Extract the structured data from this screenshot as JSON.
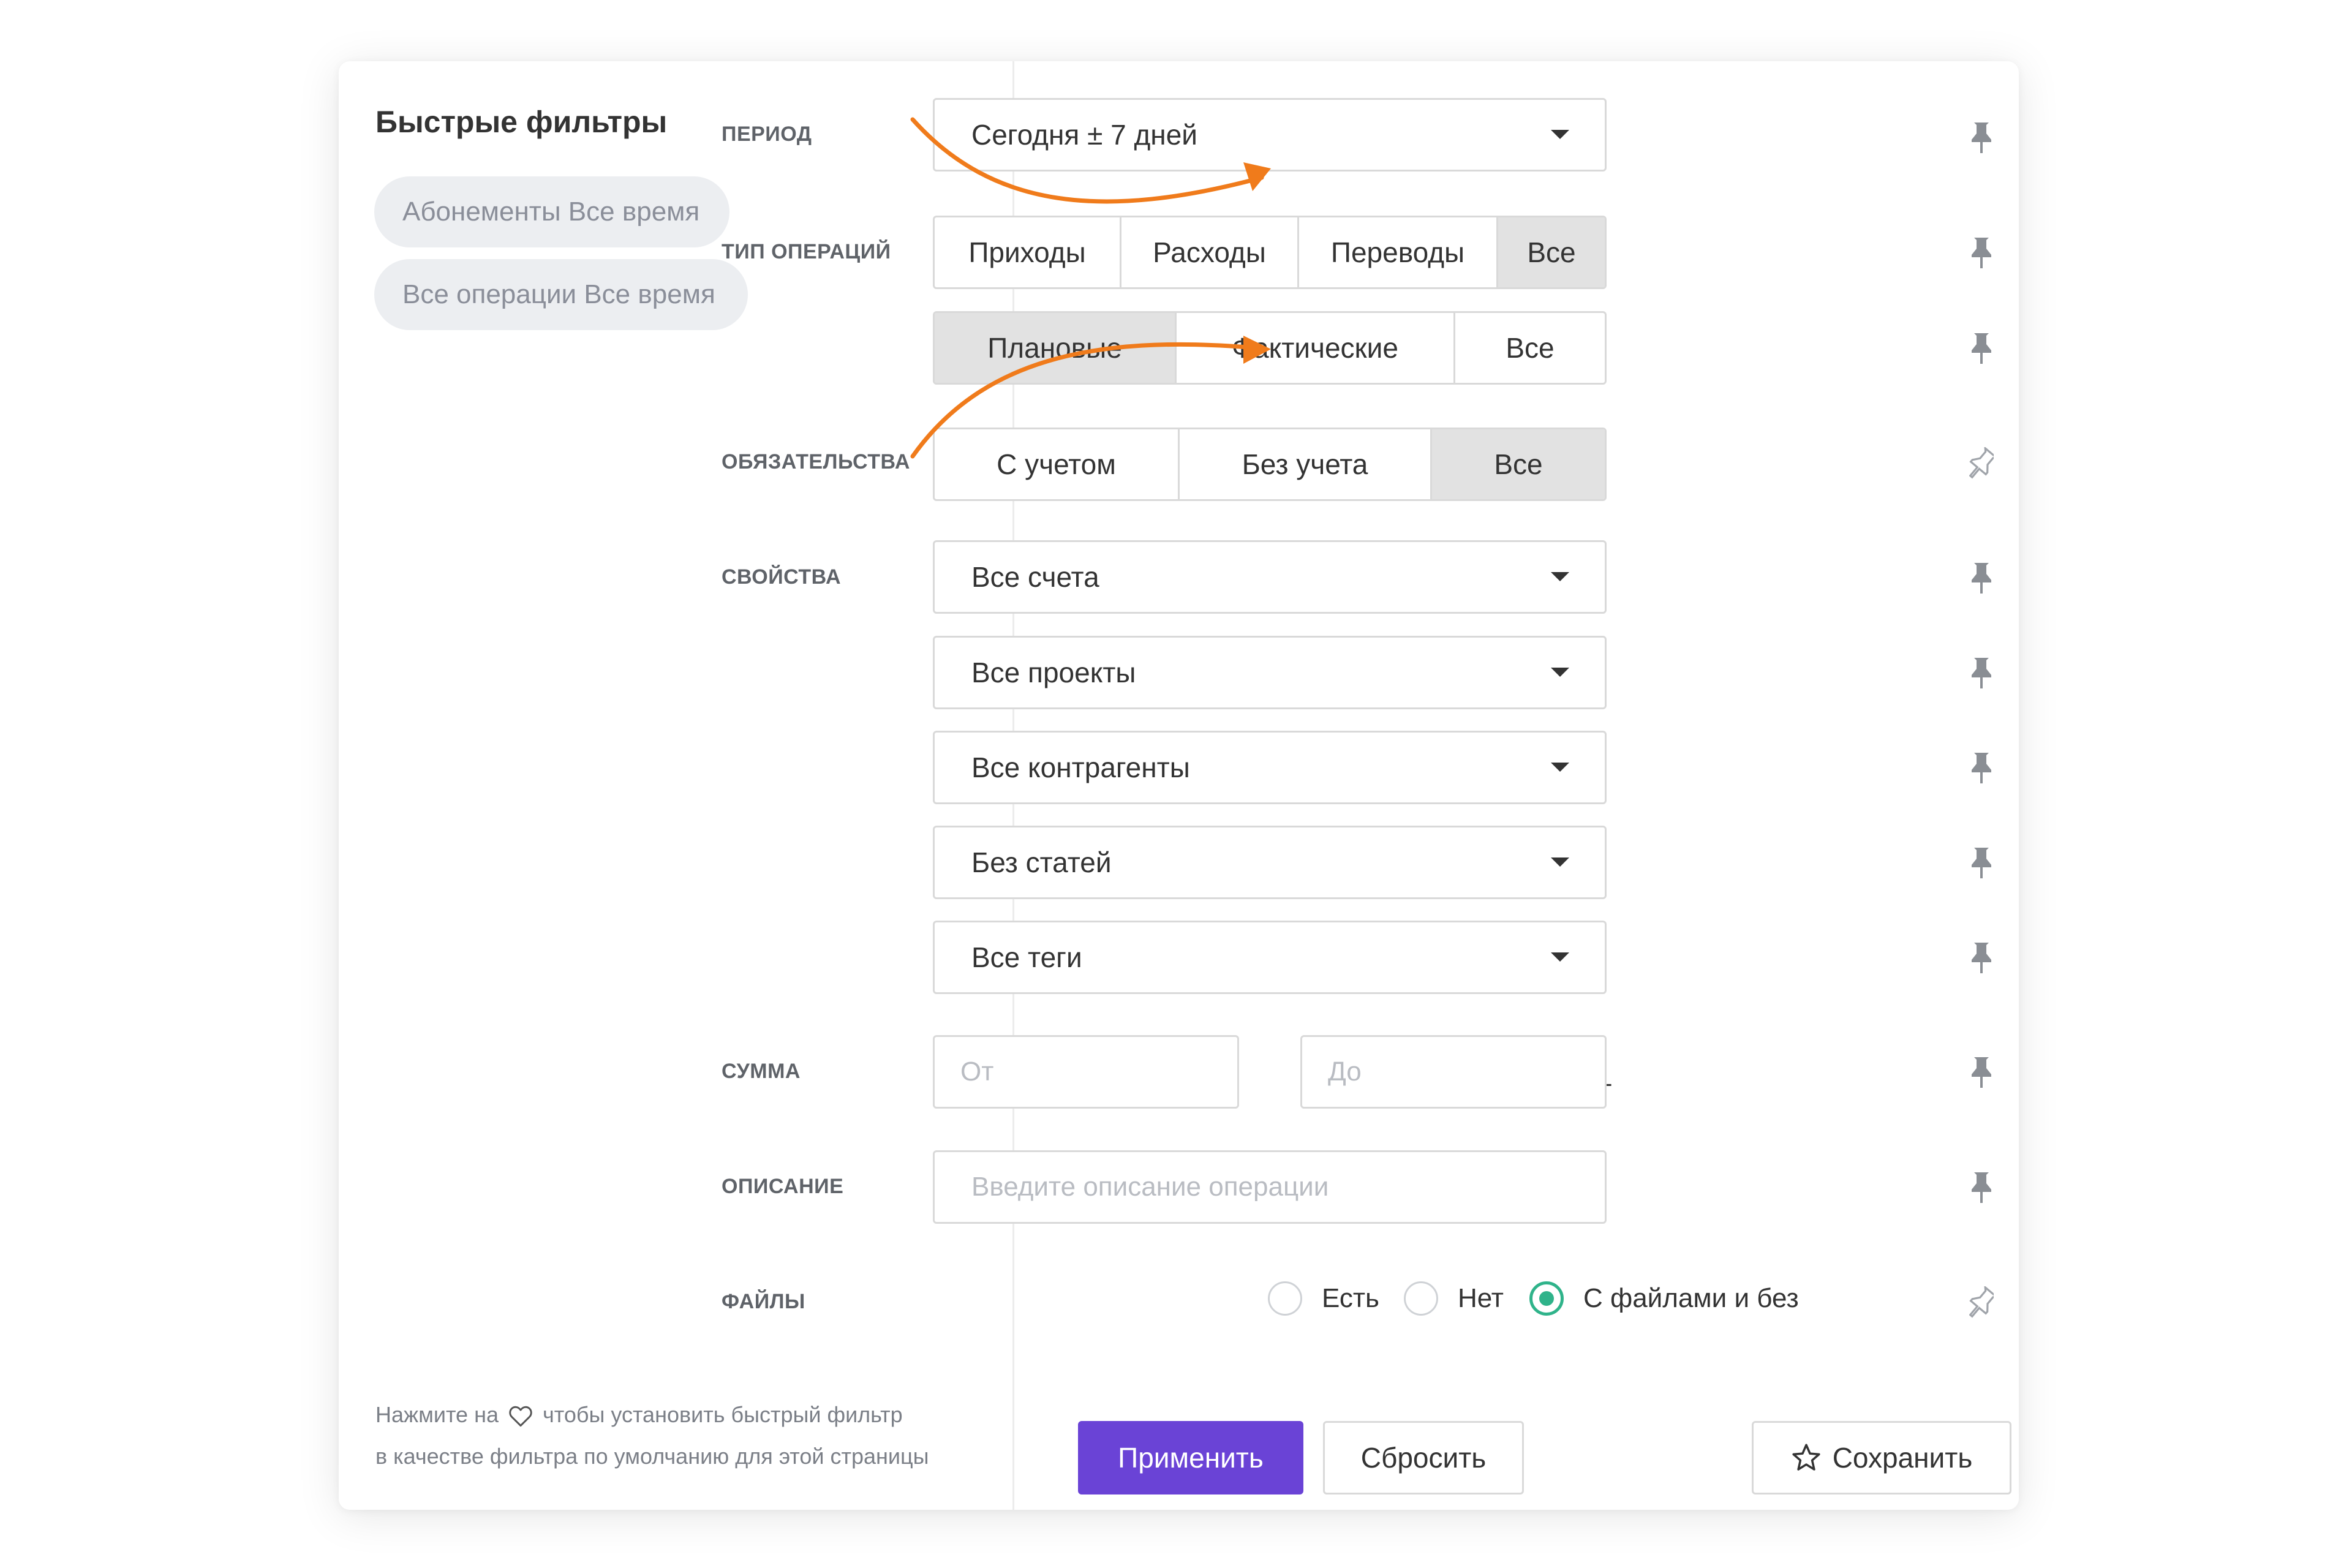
{
  "quick_filters": {
    "title": "Быстрые фильтры",
    "chips": [
      "Абонементы Все время",
      "Все операции Все время"
    ],
    "hint_line1_a": "Нажмите на",
    "hint_line1_b": "чтобы установить быстрый фильтр",
    "hint_line2": "в качестве фильтра по умолчанию для этой страницы"
  },
  "filters": {
    "period": {
      "label": "ПЕРИОД",
      "value": "Сегодня ± 7 дней"
    },
    "operation_type": {
      "label": "ТИП ОПЕРАЦИЙ",
      "kinds": [
        "Приходы",
        "Расходы",
        "Переводы",
        "Все"
      ],
      "kinds_active": "Все",
      "planning": [
        "Плановые",
        "Фактические",
        "Все"
      ],
      "planning_active": "Плановые"
    },
    "obligations": {
      "label": "ОБЯЗАТЕЛЬСТВА",
      "options": [
        "С учетом",
        "Без учета",
        "Все"
      ],
      "active": "Все"
    },
    "properties": {
      "label": "СВОЙСТВА",
      "accounts": "Все счета",
      "projects": "Все проекты",
      "counterparties": "Все контрагенты",
      "articles": "Без статей",
      "tags": "Все теги"
    },
    "amount": {
      "label": "СУММА",
      "from_placeholder": "От",
      "to_placeholder": "До",
      "separator": "–"
    },
    "description": {
      "label": "ОПИСАНИЕ",
      "placeholder": "Введите описание операции"
    },
    "files": {
      "label": "ФАЙЛЫ",
      "options": [
        "Есть",
        "Нет",
        "С файлами и без"
      ],
      "selected": "С файлами и без"
    }
  },
  "actions": {
    "apply": "Применить",
    "reset": "Сбросить",
    "save": "Сохранить"
  },
  "colors": {
    "accent": "#6a43d6",
    "radio_selected": "#2fb38a",
    "annotation_arrow": "#f07b1b",
    "active_segment": "#e2e2e2"
  }
}
